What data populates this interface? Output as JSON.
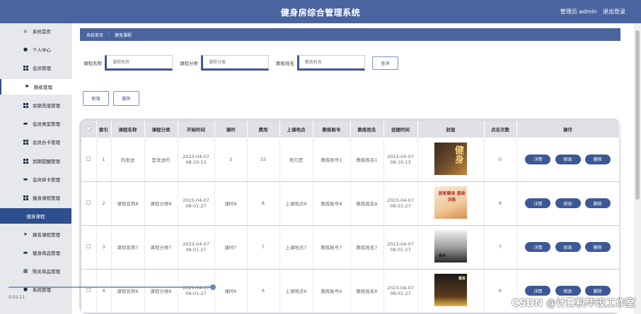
{
  "app": {
    "title": "健身房综合管理系统",
    "user_label": "管理员 admin",
    "logout_label": "退出登录"
  },
  "sidebar": {
    "items": [
      {
        "label": "系统首页",
        "icon": "home-icon"
      },
      {
        "label": "个人中心",
        "icon": "person-icon"
      },
      {
        "label": "会员管理",
        "icon": "grid-icon"
      },
      {
        "label": "教练管理",
        "icon": "flag-icon"
      },
      {
        "label": "余额充值管理",
        "icon": "grid-icon"
      },
      {
        "label": "会员类型管理",
        "icon": "card-icon"
      },
      {
        "label": "会员办卡管理",
        "icon": "grid-icon"
      },
      {
        "label": "到期提醒管理",
        "icon": "grid-icon"
      },
      {
        "label": "会员续卡管理",
        "icon": "card-icon"
      },
      {
        "label": "健身课程管理",
        "icon": "grid-icon"
      },
      {
        "label": "健身课程",
        "icon": ""
      },
      {
        "label": "报名课程管理",
        "icon": "send-icon"
      },
      {
        "label": "健身商品管理",
        "icon": "card-icon"
      },
      {
        "label": "购买商品管理",
        "icon": "building-icon"
      },
      {
        "label": "系统管理",
        "icon": "person-icon"
      }
    ]
  },
  "breadcrumb": {
    "home": "系统首页",
    "sep": "⋮",
    "current": "健身课程"
  },
  "search": {
    "course_name_label": "课程名称",
    "course_name_placeholder": "课程名称",
    "course_cat_label": "课程分类",
    "course_cat_placeholder": "课程分类",
    "coach_name_label": "教练姓名",
    "coach_name_placeholder": "教练姓名",
    "button": "查询"
  },
  "actions": {
    "add": "新增",
    "delete": "删除"
  },
  "table": {
    "headers": [
      "",
      "索引",
      "课程名称",
      "课程分类",
      "开始时间",
      "课时",
      "费用",
      "上课地点",
      "教练账号",
      "教练姓名",
      "创建时间",
      "封面",
      "点击次数",
      "操作"
    ],
    "rows": [
      {
        "idx": "1",
        "name": "的发送",
        "cat": "是发送的",
        "start": "2023-04-07 08:10:13",
        "hours": "3",
        "fee": "33",
        "place": "地方是",
        "coach_acc": "教练账号1",
        "coach_name": "教练姓名1",
        "created": "2023-04-07 08:10:13",
        "cover_text": "健身",
        "clicks": "0"
      },
      {
        "idx": "2",
        "name": "课程名称8",
        "cat": "课程分类8",
        "start": "2023-04-07 08:01:27",
        "hours": "课时8",
        "fee": "8",
        "place": "上课地点8",
        "coach_acc": "教练账号8",
        "coach_name": "教练姓名8",
        "created": "2023-04-07 08:01:27",
        "cover_text": "居家健身 基础训练",
        "clicks": "8"
      },
      {
        "idx": "3",
        "name": "课程名称7",
        "cat": "课程分类7",
        "start": "2023-04-07 08:01:27",
        "hours": "课时7",
        "fee": "7",
        "place": "上课地点7",
        "coach_acc": "教练账号7",
        "coach_name": "教练姓名7",
        "created": "2023-04-07 08:01:27",
        "cover_text": "健身",
        "clicks": "7"
      },
      {
        "idx": "4",
        "name": "课程名称6",
        "cat": "课程分类6",
        "start": "2023-04-07 08:01:27",
        "hours": "课时6",
        "fee": "6",
        "place": "上课地点6",
        "coach_acc": "教练账号6",
        "coach_name": "教练姓名6",
        "created": "2023-04-07 08:01:27",
        "cover_text": "健身",
        "clicks": "6"
      }
    ],
    "btn_detail": "详情",
    "btn_edit": "修改",
    "btn_delete": "删除"
  },
  "overlay": {
    "watermark": "CSDN @计算机毕设工作室",
    "timestamp": "0:02:11"
  },
  "colors": {
    "primary": "#4a64a0",
    "sidebar_active": "#2e4f8e",
    "pill": "#3c5896"
  }
}
